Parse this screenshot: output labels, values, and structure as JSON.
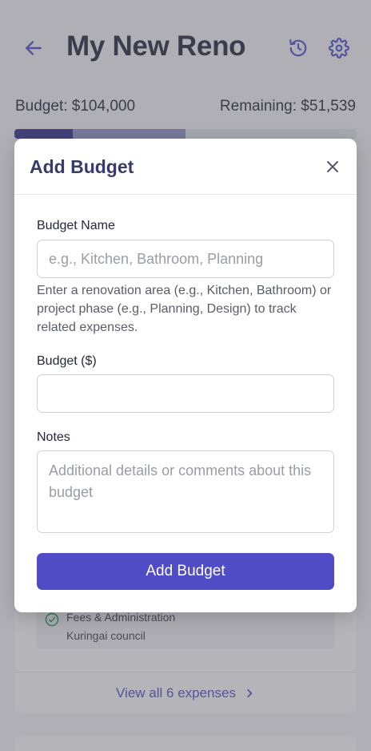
{
  "header": {
    "title": "My New Reno"
  },
  "summary": {
    "budget": "Budget: $104,000",
    "remaining": "Remaining: $51,539",
    "spent_fraction": 0.17,
    "segment_end_fraction": 0.5
  },
  "expenses": {
    "item": {
      "category": "Fees & Administration",
      "description": "Kuringai council"
    },
    "view_all": "View all 6 expenses"
  },
  "modal": {
    "title": "Add Budget",
    "name_label": "Budget Name",
    "name_placeholder": "e.g., Kitchen, Bathroom, Planning",
    "name_value": "",
    "help_text": "Enter a renovation area (e.g., Kitchen, Bathroom) or project phase (e.g., Planning, Design) to track related expenses.",
    "amount_label": "Budget ($)",
    "amount_value": "",
    "notes_label": "Notes",
    "notes_placeholder": "Additional details or comments about this budget",
    "notes_value": "",
    "submit_label": "Add Budget"
  },
  "colors": {
    "accent": "#4f4cc5",
    "progress_spent": "#2e2f8a",
    "progress_segment": "#8e91c8",
    "success": "#2f9e58"
  },
  "icons": {
    "back": "arrow-left-icon",
    "history": "history-icon",
    "settings": "gear-icon",
    "close": "close-icon",
    "check": "check-circle-icon",
    "chevron": "chevron-right-icon"
  }
}
